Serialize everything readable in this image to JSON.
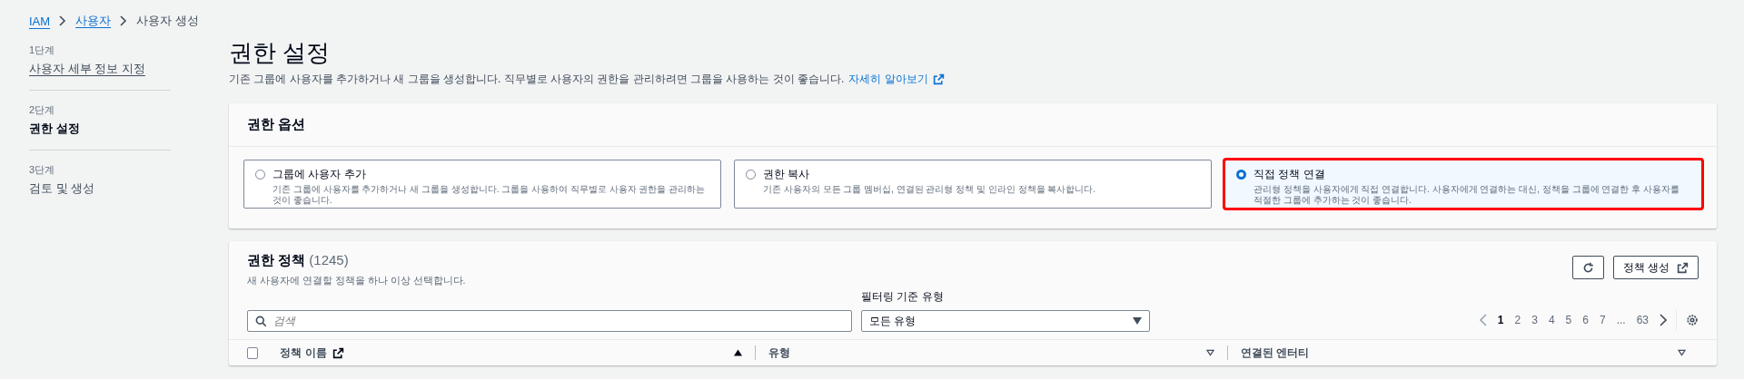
{
  "breadcrumb": [
    {
      "label": "IAM",
      "link": true
    },
    {
      "label": "사용자",
      "link": true
    },
    {
      "label": "사용자 생성",
      "link": false
    }
  ],
  "steps": [
    {
      "step": "1단계",
      "label": "사용자 세부 정보 지정",
      "selected": false,
      "link": true
    },
    {
      "step": "2단계",
      "label": "권한 설정",
      "selected": true,
      "link": false
    },
    {
      "step": "3단계",
      "label": "검토 및 생성",
      "selected": false,
      "link": false
    }
  ],
  "page": {
    "title": "권한 설정",
    "description": "기존 그룹에 사용자를 추가하거나 새 그룹을 생성합니다. 직무별로 사용자의 권한을 관리하려면 그룹을 사용하는 것이 좋습니다.",
    "link": "자세히 알아보기"
  },
  "permission_options": {
    "title": "권한 옵션",
    "options": [
      {
        "label": "그룹에 사용자 추가",
        "description": "기존 그룹에 사용자를 추가하거나 새 그룹을 생성합니다. 그룹을 사용하여 직무별로 사용자 권한을 관리하는 것이 좋습니다.",
        "selected": false,
        "highlighted": false
      },
      {
        "label": "권한 복사",
        "description": "기존 사용자의 모든 그룹 멤버십, 연결된 관리형 정책 및 인라인 정책을 복사합니다.",
        "selected": false,
        "highlighted": false
      },
      {
        "label": "직접 정책 연결",
        "description": "관리형 정책을 사용자에게 직접 연결합니다. 사용자에게 연결하는 대신, 정책을 그룹에 연결한 후 사용자를 적절한 그룹에 추가하는 것이 좋습니다.",
        "selected": true,
        "highlighted": true
      }
    ]
  },
  "policies": {
    "title": "권한 정책",
    "count": "(1245)",
    "description": "새 사용자에 연결할 정책을 하나 이상 선택합니다.",
    "create_button": "정책 생성",
    "search": {
      "placeholder": "검색"
    },
    "filter": {
      "label": "필터링 기준 유형",
      "value": "모든 유형"
    },
    "pagination": [
      {
        "label": "1",
        "selected": true
      },
      {
        "label": "2",
        "selected": false
      },
      {
        "label": "3",
        "selected": false
      },
      {
        "label": "4",
        "selected": false
      },
      {
        "label": "5",
        "selected": false
      },
      {
        "label": "6",
        "selected": false
      },
      {
        "label": "7",
        "selected": false
      },
      {
        "label": "...",
        "selected": false
      },
      {
        "label": "63",
        "selected": false
      }
    ],
    "select_all": {
      "checked": false
    },
    "columns": [
      {
        "label": "정책 이름",
        "external_link": true,
        "sorted": true
      },
      {
        "label": "유형",
        "external_link": false,
        "sorted": false
      },
      {
        "label": "연결된 엔터티",
        "external_link": false,
        "sorted": false
      }
    ]
  }
}
